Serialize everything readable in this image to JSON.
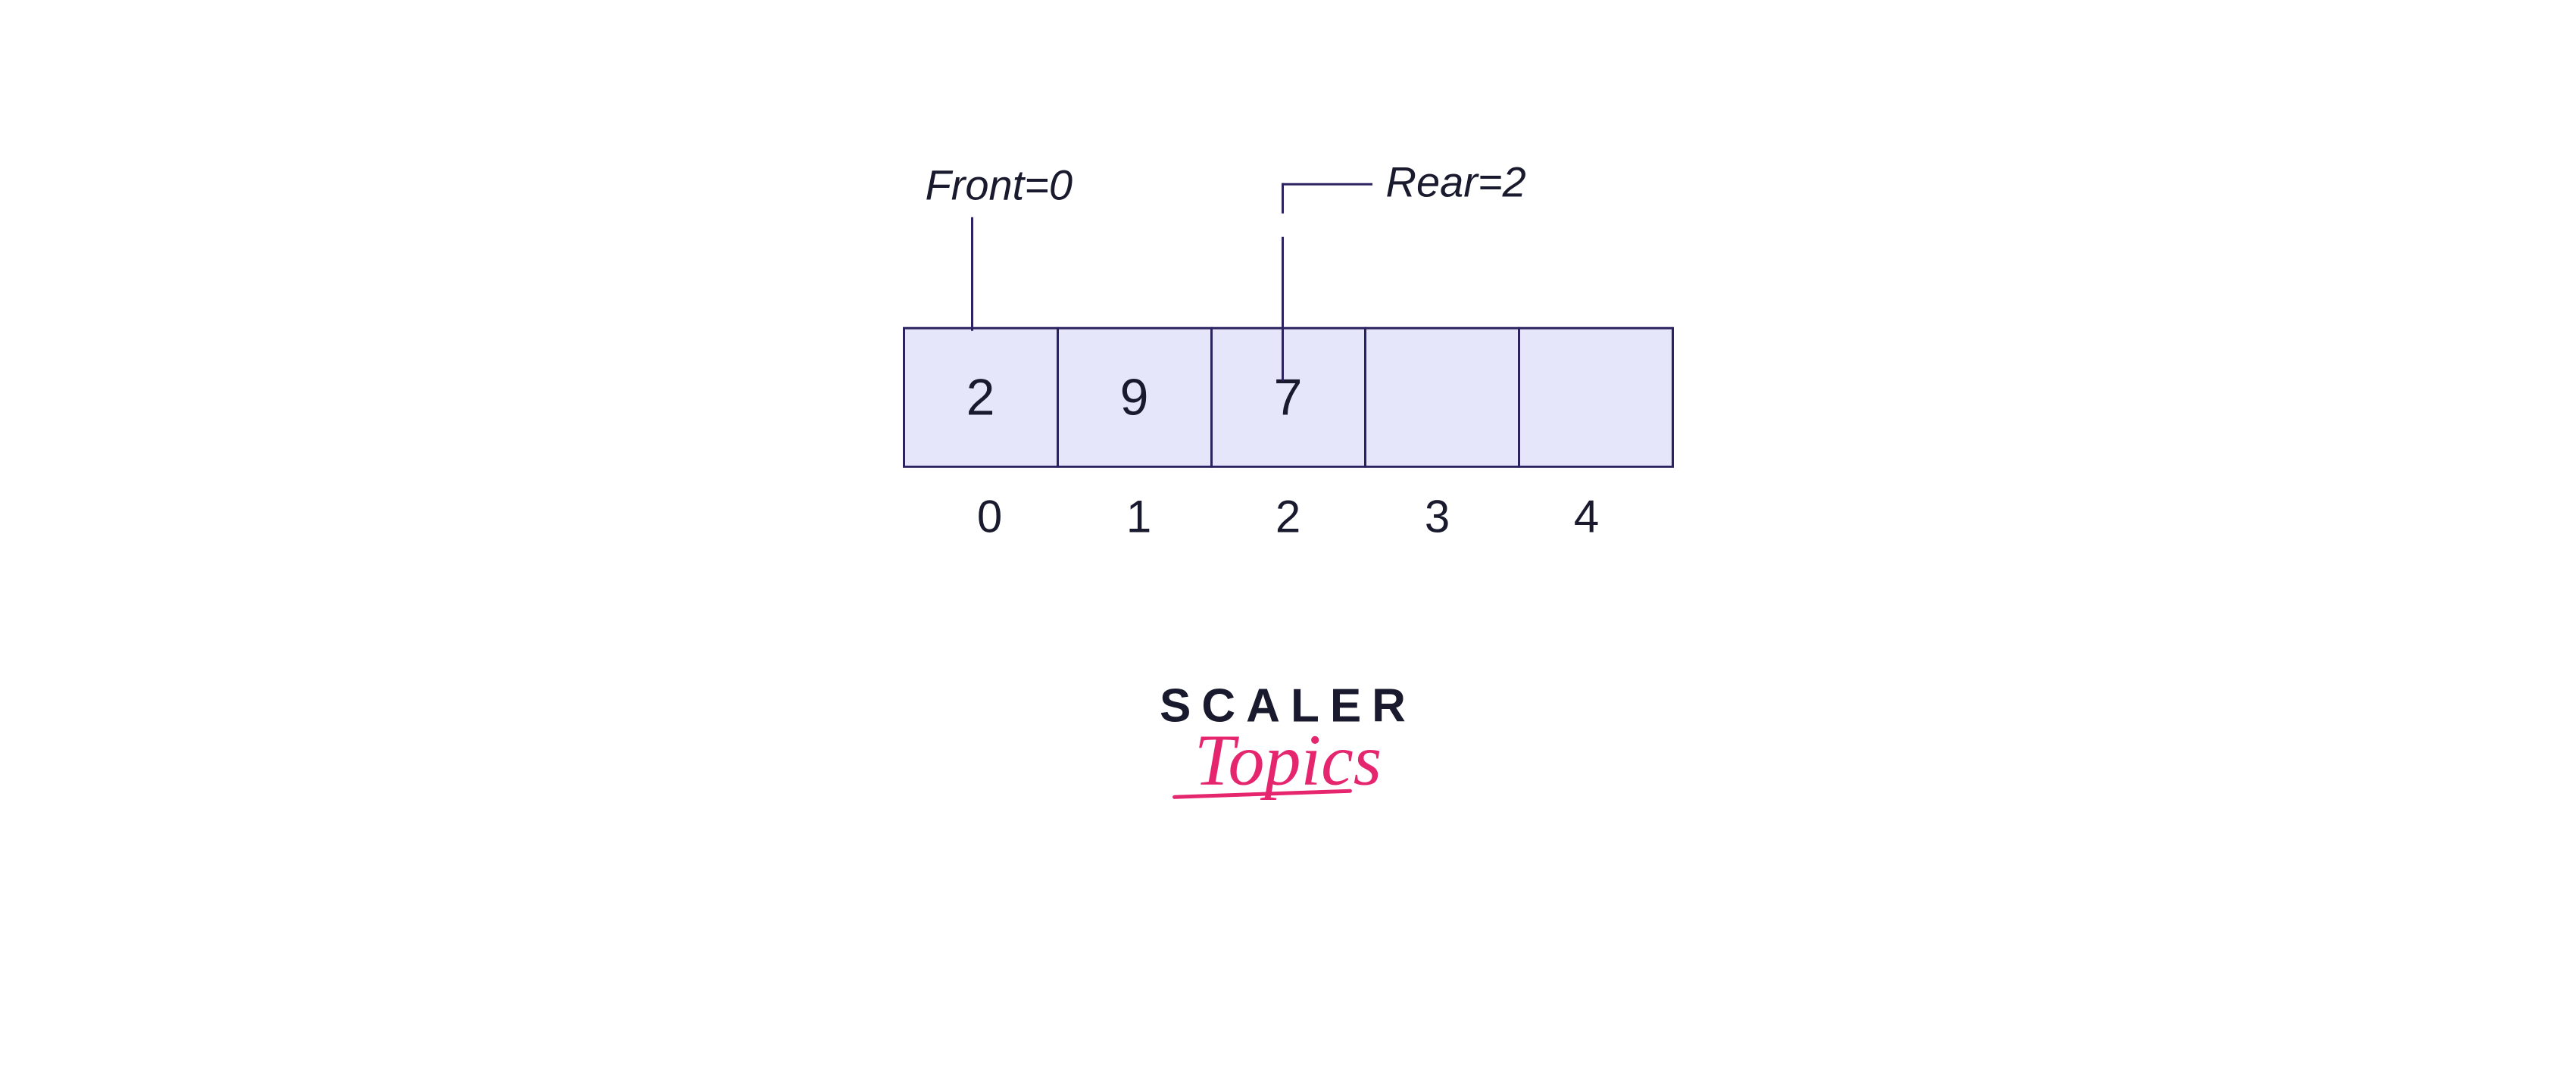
{
  "queue": {
    "front_label": "Front=0",
    "rear_label": "Rear=2",
    "front_index": 0,
    "rear_index": 2,
    "cells": [
      "2",
      "9",
      "7",
      "",
      ""
    ],
    "indices": [
      "0",
      "1",
      "2",
      "3",
      "4"
    ]
  },
  "logo": {
    "line1": "SCALER",
    "line2": "Topics"
  },
  "colors": {
    "cell_fill": "#e6e6fa",
    "cell_border": "#2b2260",
    "text": "#1a1a2e",
    "accent": "#e6256f"
  }
}
